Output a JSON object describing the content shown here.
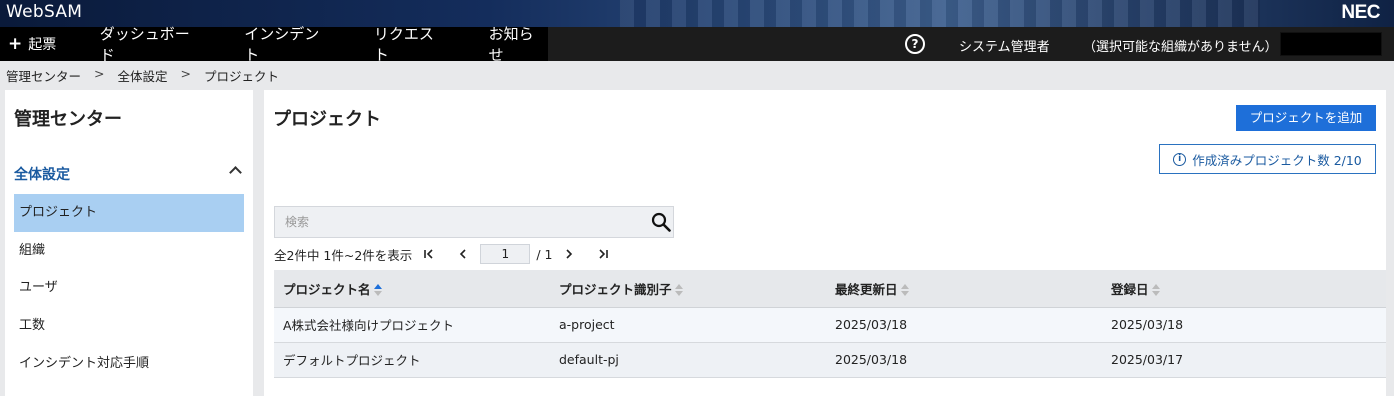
{
  "app": {
    "title": "WebSAM",
    "brand": "NEC"
  },
  "nav": {
    "create_label": "起票",
    "items": [
      "ダッシュボード",
      "インシデント",
      "リクエスト",
      "お知らせ"
    ],
    "help_icon": "?",
    "user": "システム管理者",
    "org": "（選択可能な組織がありません）"
  },
  "breadcrumb": [
    "管理センター",
    "全体設定",
    "プロジェクト"
  ],
  "breadcrumb_sep": ">",
  "sidebar": {
    "title": "管理センター",
    "section": "全体設定",
    "items": [
      {
        "label": "プロジェクト",
        "active": true
      },
      {
        "label": "組織",
        "active": false
      },
      {
        "label": "ユーザ",
        "active": false
      },
      {
        "label": "工数",
        "active": false
      },
      {
        "label": "インシデント対応手順",
        "active": false
      }
    ]
  },
  "main": {
    "title": "プロジェクト",
    "add_button": "プロジェクトを追加",
    "count_label": "作成済みプロジェクト数 2/10",
    "search_placeholder": "検索",
    "pager": {
      "summary": "全2件中 1件~2件を表示",
      "current_page": "1",
      "total": "/ 1"
    },
    "table": {
      "headers": [
        "プロジェクト名",
        "プロジェクト識別子",
        "最終更新日",
        "登録日"
      ],
      "rows": [
        [
          "A株式会社様向けプロジェクト",
          "a-project",
          "2025/03/18",
          "2025/03/18"
        ],
        [
          "デフォルトプロジェクト",
          "default-pj",
          "2025/03/18",
          "2025/03/17"
        ]
      ]
    }
  },
  "colors": {
    "primary": "#1e6fd9",
    "active_item": "#a9cff2",
    "section": "#1a5aa0"
  }
}
